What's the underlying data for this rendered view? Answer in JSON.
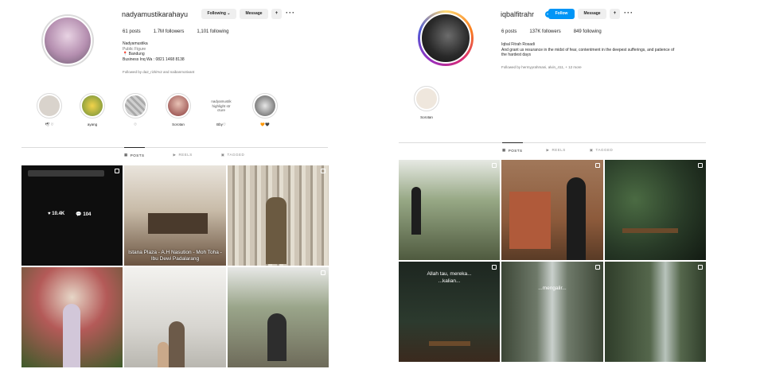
{
  "left": {
    "username": "nadyamustikarahayu",
    "following_button": "Following ⌄",
    "message_button": "Message",
    "add_user_button": "+",
    "more": "···",
    "stats": {
      "posts": "61 posts",
      "followers": "1.7M followers",
      "following": "1,101 following"
    },
    "bio": {
      "name": "Nadyamustika",
      "category": "Public Figure",
      "location": "📍 Bandung",
      "business": "Business Inq Wa : 0821 1468 8138"
    },
    "followed_by": "Followed by da2_rizki%2 and naibanmotivant",
    "highlights": [
      {
        "label": "🕊 ♡",
        "color": "#d9d3cc"
      },
      {
        "label": "ayang",
        "color": "#e0c24a"
      },
      {
        "label": "♡",
        "color": "#b8b8b8"
      },
      {
        "label": "Sorotan",
        "color": "#8a3b3b"
      },
      {
        "label": "Bby♡",
        "inner_text": "nadyamustik highlight str cture",
        "color": "#ffffff"
      },
      {
        "label": "🧡🖤",
        "color": "#6d6d6d"
      }
    ],
    "tabs": {
      "posts": "POSTS",
      "reels": "REELS",
      "tagged": "TAGGED"
    },
    "tiles": [
      {
        "kind": "stats",
        "likes": "♥ 10.4K",
        "comments": "💬 104",
        "color": "#0e0e0e"
      },
      {
        "kind": "caption",
        "caption": "Istana Plaza - A.H Nasution - Moh Toha - Ibu Dewi Padalarang",
        "color": "#a18b72"
      },
      {
        "kind": "photo",
        "color": "#c9c1b4"
      },
      {
        "kind": "photo",
        "color": "#b45a58"
      },
      {
        "kind": "photo",
        "color": "#d7d5d0"
      },
      {
        "kind": "photo",
        "color": "#6e6b5a"
      }
    ]
  },
  "right": {
    "username": "iqbalfitrahr",
    "verified": "✓",
    "follow_button": "Follow",
    "message_button": "Message",
    "add_user_button": "+",
    "more": "···",
    "stats": {
      "posts": "6 posts",
      "followers": "137K followers",
      "following": "849 following"
    },
    "bio": {
      "name": "Iqbal Fitrah Rosadi",
      "line1": "And grant us resurance in the midst of fear, contentment in the deepest sufferings, and patience of",
      "line2": "the hardest days"
    },
    "followed_by": "Followed by hermyyrahmani, alvin_411, + 12 more",
    "highlights": [
      {
        "label": "Sorotan",
        "color": "#efe7dd"
      }
    ],
    "tabs": {
      "posts": "POSTS",
      "reels": "REELS",
      "tagged": "TAGGED"
    },
    "tiles": [
      {
        "kind": "photo",
        "color": "#6f7c5e"
      },
      {
        "kind": "photo",
        "color": "#8c5a3b"
      },
      {
        "kind": "photo",
        "color": "#283a27"
      },
      {
        "kind": "text",
        "line1": "Allah tau, mereka...",
        "line2": "...kalian...",
        "color": "#1d2620"
      },
      {
        "kind": "text",
        "line1": "",
        "line2": "...mengalir...",
        "color": "#3c4636"
      },
      {
        "kind": "photo",
        "color": "#2f3d2a"
      }
    ]
  }
}
